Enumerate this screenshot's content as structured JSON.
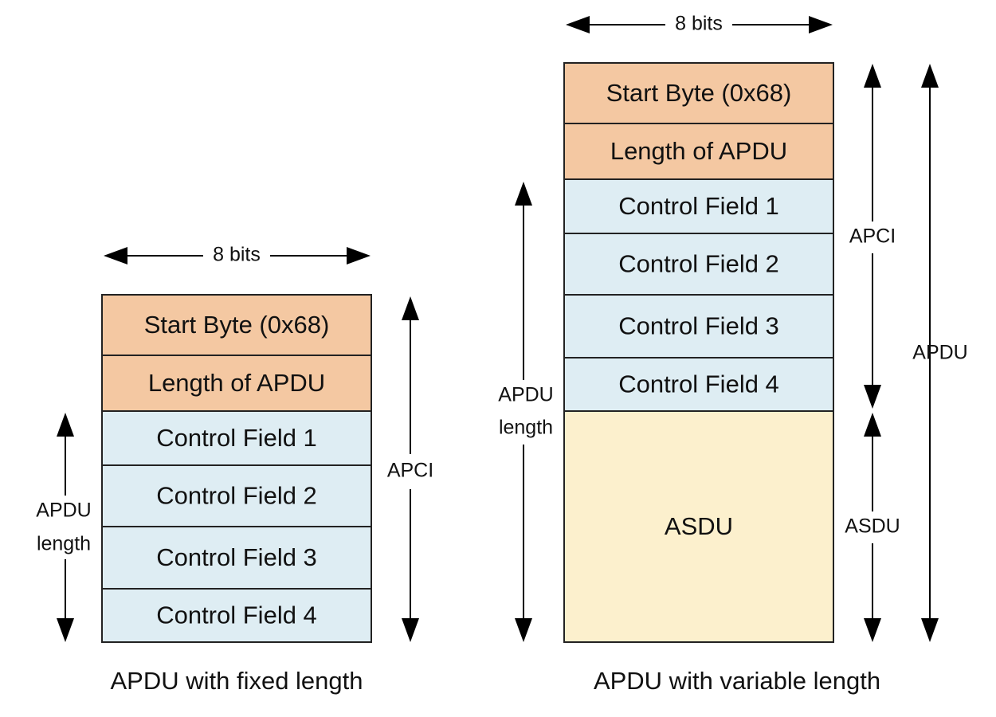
{
  "colors": {
    "header": "#f4c8a2",
    "control": "#deedf3",
    "asdu": "#fcf0cd",
    "stroke": "#222222"
  },
  "fixed": {
    "width_label": "8 bits",
    "fields": [
      {
        "label": "Start Byte (0x68)",
        "kind": "header"
      },
      {
        "label": "Length of APDU",
        "kind": "header"
      },
      {
        "label": "Control Field 1",
        "kind": "control"
      },
      {
        "label": "Control Field 2",
        "kind": "control"
      },
      {
        "label": "Control Field 3",
        "kind": "control"
      },
      {
        "label": "Control Field 4",
        "kind": "control"
      }
    ],
    "apci_label": "APCI",
    "apdu_length_label": [
      "APDU",
      "length"
    ],
    "caption": "APDU with fixed length"
  },
  "variable": {
    "width_label": "8 bits",
    "fields": [
      {
        "label": "Start Byte (0x68)",
        "kind": "header"
      },
      {
        "label": "Length of APDU",
        "kind": "header"
      },
      {
        "label": "Control Field 1",
        "kind": "control"
      },
      {
        "label": "Control Field 2",
        "kind": "control"
      },
      {
        "label": "Control Field 3",
        "kind": "control"
      },
      {
        "label": "Control Field 4",
        "kind": "control"
      },
      {
        "label": "ASDU",
        "kind": "asdu"
      }
    ],
    "apci_label": "APCI",
    "asdu_label": "ASDU",
    "apdu_label": "APDU",
    "apdu_length_label": [
      "APDU",
      "length"
    ],
    "caption": "APDU with variable length"
  }
}
